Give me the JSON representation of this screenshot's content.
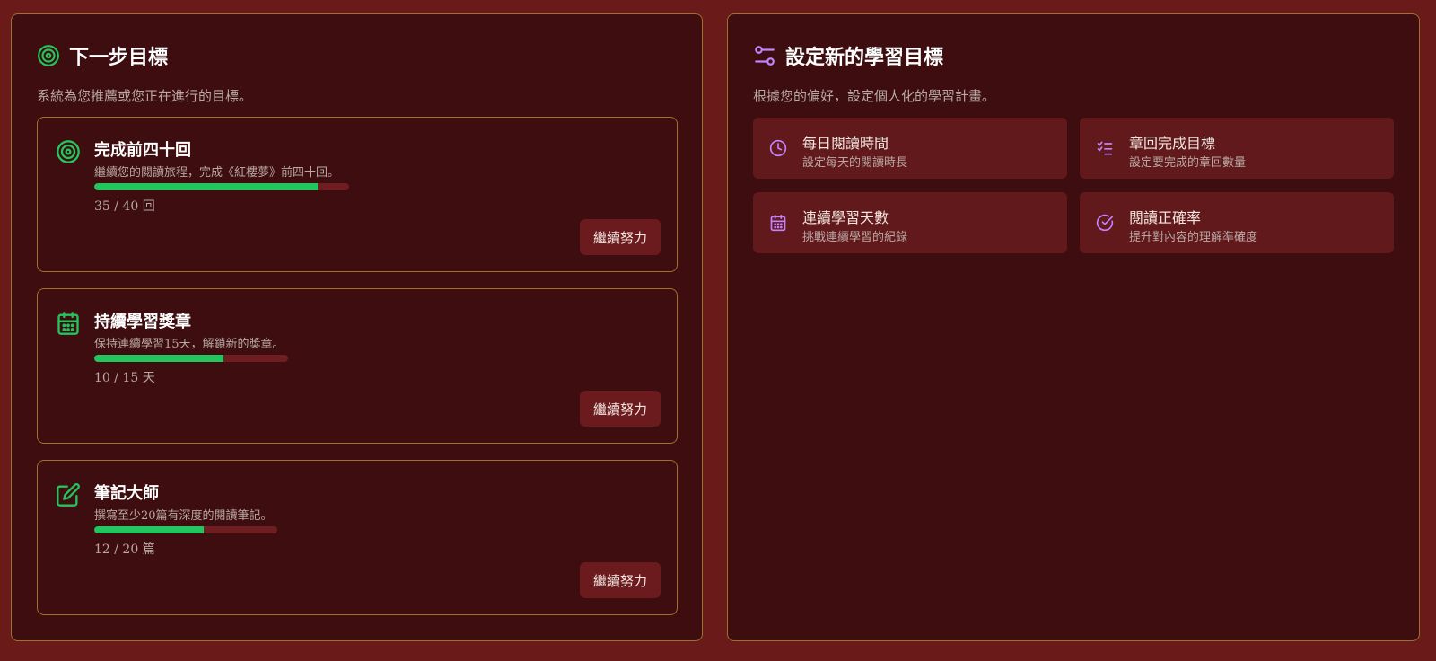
{
  "colors": {
    "background": "#6b1a1a",
    "panel": "#3d0d0f",
    "border": "#a0712a",
    "progress_fill": "#22c55e",
    "progress_track": "#6e1d20",
    "accent_green": "#22c55e",
    "accent_purple": "#c084fc"
  },
  "next_goals": {
    "title": "下一步目標",
    "subtitle": "系統為您推薦或您正在進行的目標。",
    "icon": "target-icon",
    "goals": [
      {
        "title": "完成前四十回",
        "description": "繼續您的閱讀旅程，完成《紅樓夢》前四十回。",
        "progress_text": "35 / 40 回",
        "current": 35,
        "total": 40,
        "button_label": "繼續努力",
        "icon": "target-icon"
      },
      {
        "title": "持續學習獎章",
        "description": "保持連續學習15天，解鎖新的獎章。",
        "progress_text": "10 / 15 天",
        "current": 10,
        "total": 15,
        "button_label": "繼續努力",
        "icon": "calendar-icon"
      },
      {
        "title": "筆記大師",
        "description": "撰寫至少20篇有深度的閱讀筆記。",
        "progress_text": "12 / 20 篇",
        "current": 12,
        "total": 20,
        "button_label": "繼續努力",
        "icon": "edit-icon"
      }
    ]
  },
  "new_goal": {
    "title": "設定新的學習目標",
    "subtitle": "根據您的偏好，設定個人化的學習計畫。",
    "icon": "sliders-icon",
    "options": [
      {
        "title": "每日閱讀時間",
        "description": "設定每天的閱讀時長",
        "icon": "clock-icon"
      },
      {
        "title": "章回完成目標",
        "description": "設定要完成的章回數量",
        "icon": "list-check-icon"
      },
      {
        "title": "連續學習天數",
        "description": "挑戰連續學習的紀錄",
        "icon": "calendar-icon"
      },
      {
        "title": "閱讀正確率",
        "description": "提升對內容的理解準確度",
        "icon": "check-circle-icon"
      }
    ]
  }
}
